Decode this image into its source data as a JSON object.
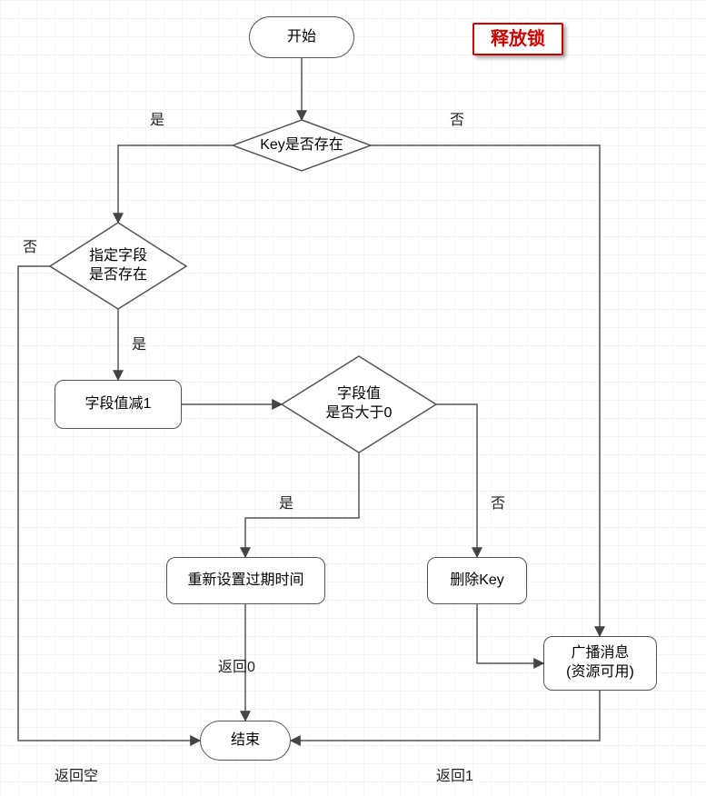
{
  "title": "释放锁",
  "nodes": {
    "start": "开始",
    "end": "结束",
    "d_key_exists": "Key是否存在",
    "d_field_exists": "指定字段\n是否存在",
    "p_decr": "字段值减1",
    "d_gt0": "字段值\n是否大于0",
    "p_reset_ttl": "重新设置过期时间",
    "p_del_key": "删除Key",
    "p_broadcast": "广播消息\n(资源可用)"
  },
  "edges": {
    "yes": "是",
    "no": "否",
    "return0": "返回0",
    "return1": "返回1",
    "return_empty": "返回空"
  },
  "chart_data": {
    "type": "flowchart",
    "title": "释放锁",
    "nodes": [
      {
        "id": "start",
        "type": "terminator",
        "label": "开始"
      },
      {
        "id": "d_key_exists",
        "type": "decision",
        "label": "Key是否存在"
      },
      {
        "id": "d_field_exists",
        "type": "decision",
        "label": "指定字段是否存在"
      },
      {
        "id": "p_decr",
        "type": "process",
        "label": "字段值减1"
      },
      {
        "id": "d_gt0",
        "type": "decision",
        "label": "字段值是否大于0"
      },
      {
        "id": "p_reset_ttl",
        "type": "process",
        "label": "重新设置过期时间"
      },
      {
        "id": "p_del_key",
        "type": "process",
        "label": "删除Key"
      },
      {
        "id": "p_broadcast",
        "type": "process",
        "label": "广播消息(资源可用)"
      },
      {
        "id": "end",
        "type": "terminator",
        "label": "结束"
      }
    ],
    "edges": [
      {
        "from": "start",
        "to": "d_key_exists"
      },
      {
        "from": "d_key_exists",
        "to": "d_field_exists",
        "label": "是"
      },
      {
        "from": "d_key_exists",
        "to": "p_broadcast",
        "label": "否"
      },
      {
        "from": "d_field_exists",
        "to": "p_decr",
        "label": "是"
      },
      {
        "from": "d_field_exists",
        "to": "end",
        "label": "否 / 返回空"
      },
      {
        "from": "p_decr",
        "to": "d_gt0"
      },
      {
        "from": "d_gt0",
        "to": "p_reset_ttl",
        "label": "是"
      },
      {
        "from": "d_gt0",
        "to": "p_del_key",
        "label": "否"
      },
      {
        "from": "p_reset_ttl",
        "to": "end",
        "label": "返回0"
      },
      {
        "from": "p_del_key",
        "to": "p_broadcast"
      },
      {
        "from": "p_broadcast",
        "to": "end",
        "label": "返回1"
      }
    ]
  }
}
